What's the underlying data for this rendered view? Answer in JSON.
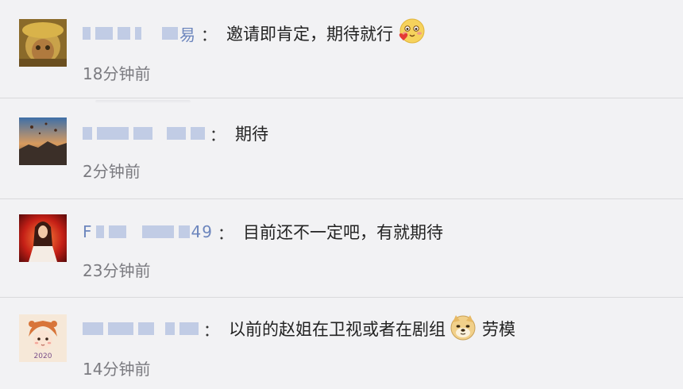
{
  "comments": [
    {
      "username_tail": "易",
      "colon": "：",
      "text": "邀请即肯定，期待就行",
      "emoji": "blush-heart-emoji",
      "time": "18分钟前"
    },
    {
      "username_tail": "",
      "colon": "：",
      "text": "期待",
      "emoji": "",
      "time": "2分钟前"
    },
    {
      "username_head": "F",
      "username_tail": "49",
      "colon": "：",
      "text": "目前还不一定吧，有就期待",
      "emoji": "",
      "time": "23分钟前"
    },
    {
      "username_tail": "",
      "colon": "：",
      "text": "以前的赵姐在卫视或者在剧组",
      "emoji": "doge-emoji",
      "text_after": "劳模",
      "time": "14分钟前"
    }
  ],
  "colors": {
    "background": "#f2f2f4",
    "username": "#5b79b4",
    "time": "#7b7b80",
    "divider": "#d9d9dc"
  }
}
